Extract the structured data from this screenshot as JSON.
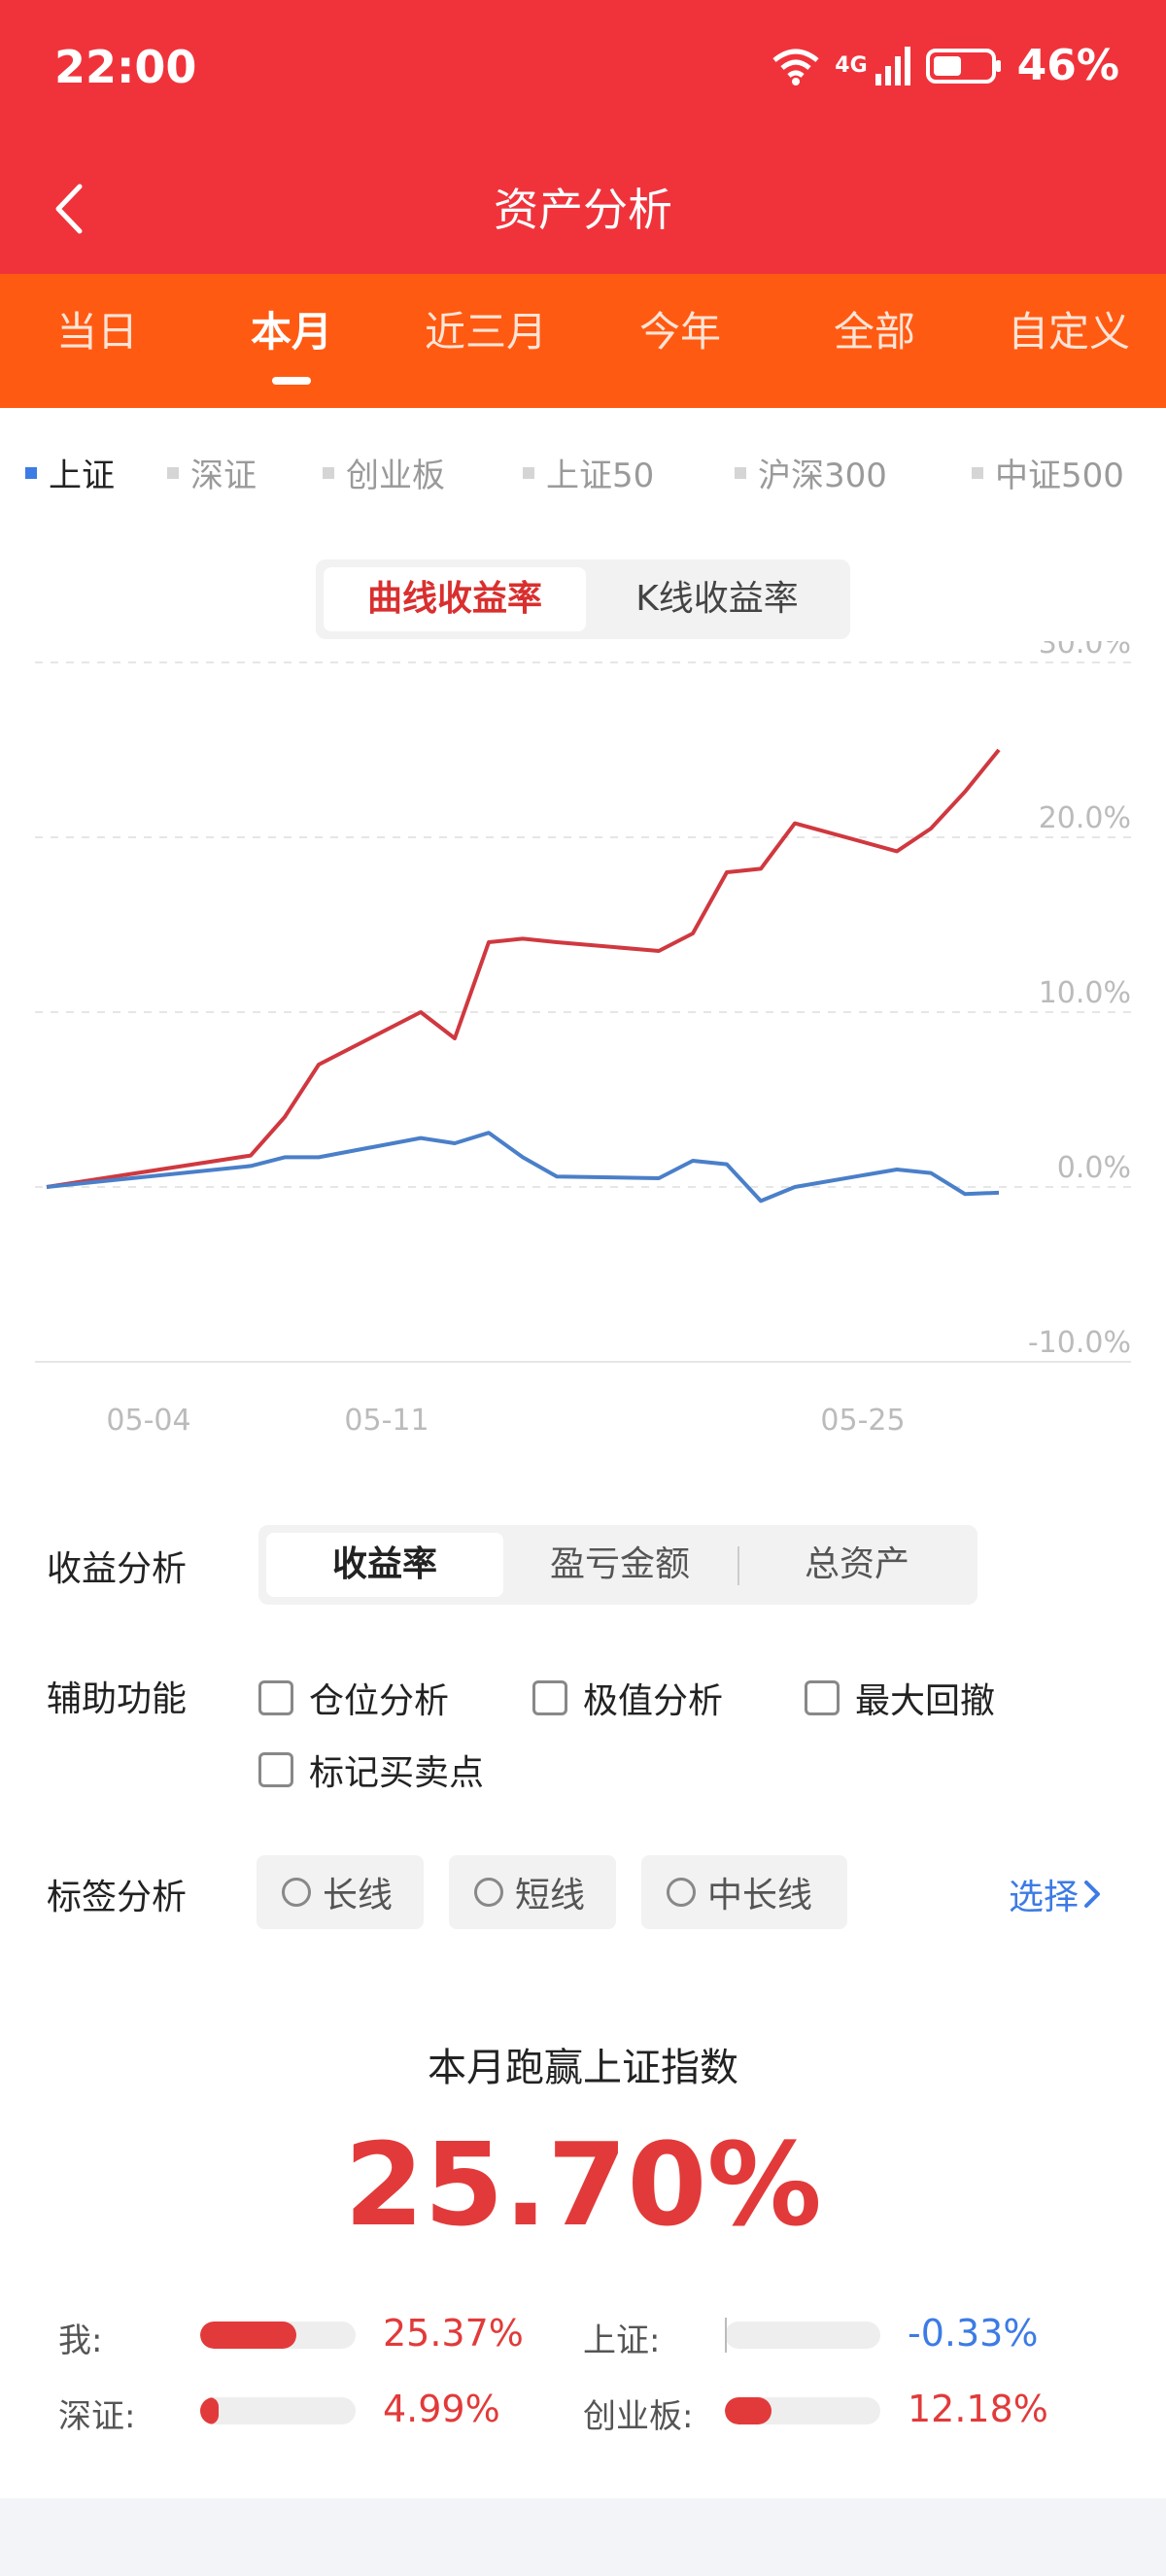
{
  "status": {
    "time": "22:00",
    "battery": "46%",
    "network": "4G"
  },
  "header": {
    "title": "资产分析"
  },
  "period_tabs": [
    "当日",
    "本月",
    "近三月",
    "今年",
    "全部",
    "自定义"
  ],
  "period_active": 1,
  "index_tabs": [
    "上证",
    "深证",
    "创业板",
    "上证50",
    "沪深300",
    "中证500"
  ],
  "index_active": 0,
  "chart_toggle": {
    "curve": "曲线收益率",
    "kline": "K线收益率"
  },
  "chart_data": {
    "type": "line",
    "y_ticks": [
      "30.0%",
      "20.0%",
      "10.0%",
      "0.0%",
      "-10.0%"
    ],
    "ylim": [
      -10,
      30
    ],
    "x_ticks": [
      "05-04",
      "05-11",
      "05-25"
    ],
    "grid": true,
    "series": [
      {
        "color": "#d0383f",
        "points": [
          [
            0,
            0
          ],
          [
            6,
            1.8
          ],
          [
            7,
            4
          ],
          [
            8,
            7
          ],
          [
            11,
            10
          ],
          [
            12,
            8.5
          ],
          [
            13,
            14
          ],
          [
            14,
            14.2
          ],
          [
            15,
            14
          ],
          [
            18,
            13.5
          ],
          [
            19,
            14.5
          ],
          [
            20,
            18
          ],
          [
            21,
            18.2
          ],
          [
            22,
            20.8
          ],
          [
            25,
            19.2
          ],
          [
            26,
            20.5
          ],
          [
            27,
            22.6
          ],
          [
            28,
            25
          ]
        ]
      },
      {
        "color": "#4a7fc9",
        "points": [
          [
            0,
            0
          ],
          [
            6,
            1.2
          ],
          [
            7,
            1.7
          ],
          [
            8,
            1.7
          ],
          [
            11,
            2.8
          ],
          [
            12,
            2.5
          ],
          [
            13,
            3.1
          ],
          [
            14,
            1.7
          ],
          [
            15,
            0.6
          ],
          [
            18,
            0.5
          ],
          [
            19,
            1.5
          ],
          [
            20,
            1.3
          ],
          [
            21,
            -0.8
          ],
          [
            22,
            0
          ],
          [
            25,
            1
          ],
          [
            26,
            0.8
          ],
          [
            27,
            -0.4
          ],
          [
            28,
            -0.33
          ]
        ]
      }
    ]
  },
  "analysis": {
    "label": "收益分析",
    "options": [
      "收益率",
      "盈亏金额",
      "总资产"
    ],
    "active": 0
  },
  "aux": {
    "label": "辅助功能",
    "options": [
      "仓位分析",
      "极值分析",
      "最大回撤",
      "标记买卖点"
    ]
  },
  "tags": {
    "label": "标签分析",
    "options": [
      "长线",
      "短线",
      "中长线"
    ],
    "select": "选择"
  },
  "summary": {
    "title": "本月跑赢上证指数",
    "value": "25.70%"
  },
  "comparisons": [
    {
      "label": "我:",
      "value": "25.37%",
      "fill": 0.62,
      "tone": "red"
    },
    {
      "label": "上证:",
      "value": "-0.33%",
      "fill": 0.0,
      "tone": "blue"
    },
    {
      "label": "深证:",
      "value": "4.99%",
      "fill": 0.12,
      "tone": "red"
    },
    {
      "label": "创业板:",
      "value": "12.18%",
      "fill": 0.3,
      "tone": "red"
    }
  ]
}
